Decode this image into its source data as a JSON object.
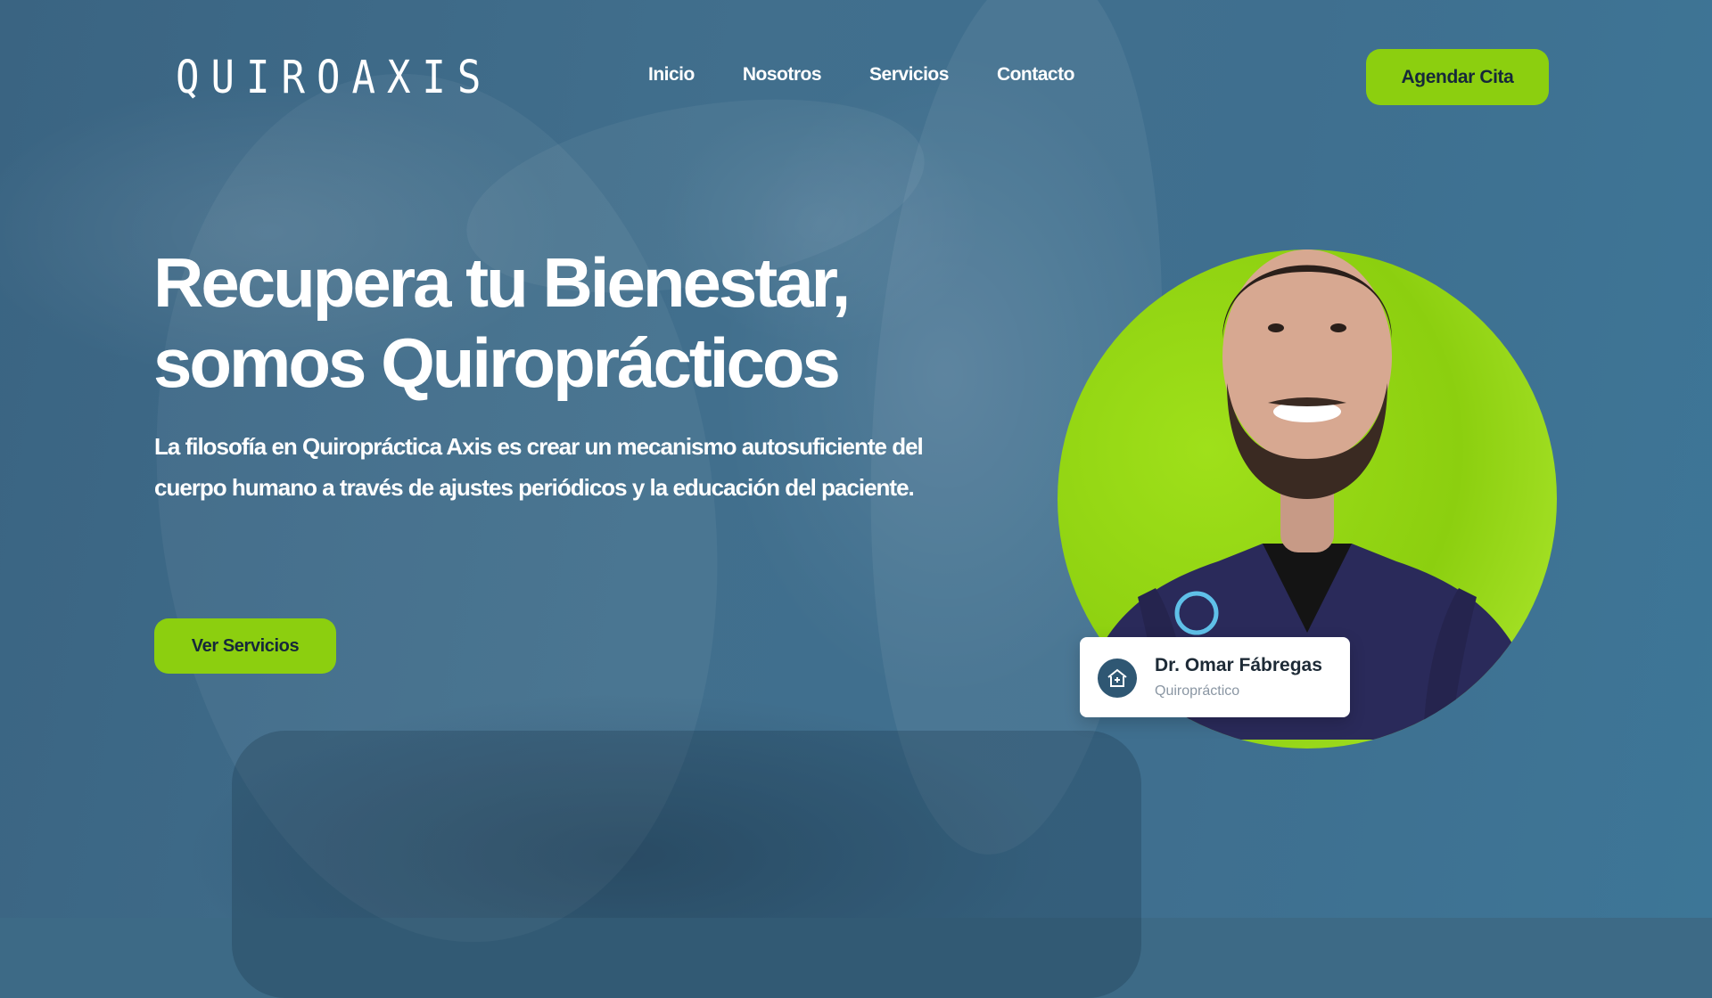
{
  "brand": {
    "logo_text": "QUIROAXIS"
  },
  "nav": {
    "items": [
      {
        "label": "Inicio"
      },
      {
        "label": "Nosotros"
      },
      {
        "label": "Servicios"
      },
      {
        "label": "Contacto"
      }
    ],
    "cta_label": "Agendar Cita"
  },
  "hero": {
    "title_line1": "Recupera tu Bienestar,",
    "title_line2": "somos Quiroprácticos",
    "subtitle": "La filosofía en Quiropráctica Axis es crear un mecanismo autosuficiente del cuerpo humano a través de ajustes periódicos y la educación del paciente.",
    "cta_label": "Ver Servicios"
  },
  "doctor_card": {
    "name": "Dr. Omar Fábregas",
    "role": "Quiropráctico",
    "icon": "clinic-house-icon"
  },
  "colors": {
    "accent": "#8ccf0f",
    "background": "#3d6a86",
    "button_text": "#16283a"
  }
}
